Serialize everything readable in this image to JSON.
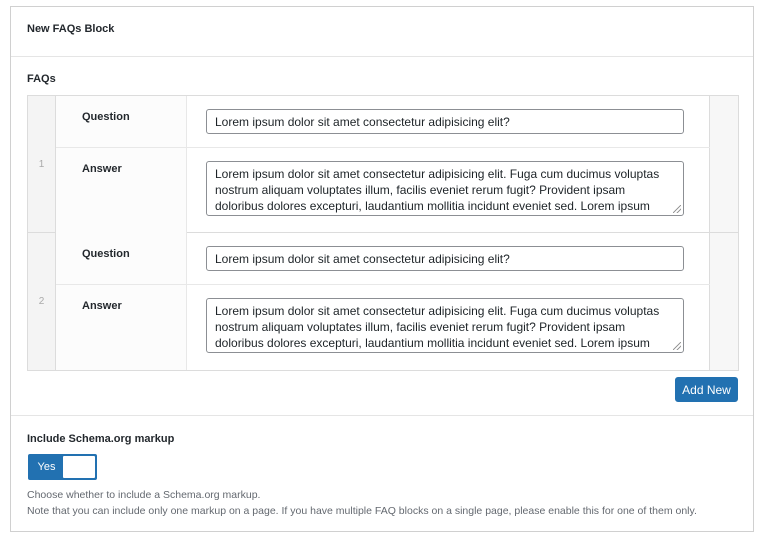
{
  "block_title": "New FAQs Block",
  "faqs_label": "FAQs",
  "rows": [
    {
      "number": "1",
      "question_label": "Question",
      "question_value": "Lorem ipsum dolor sit amet consectetur adipisicing elit?",
      "answer_label": "Answer",
      "answer_value": "Lorem ipsum dolor sit amet consectetur adipisicing elit. Fuga cum ducimus voluptas nostrum aliquam voluptates illum, facilis eveniet rerum fugit? Provident ipsam doloribus dolores excepturi, laudantium mollitia incidunt eveniet sed. Lorem ipsum dolor sit amet"
    },
    {
      "number": "2",
      "question_label": "Question",
      "question_value": "Lorem ipsum dolor sit amet consectetur adipisicing elit?",
      "answer_label": "Answer",
      "answer_value": "Lorem ipsum dolor sit amet consectetur adipisicing elit. Fuga cum ducimus voluptas nostrum aliquam voluptates illum, facilis eveniet rerum fugit? Provident ipsam doloribus dolores excepturi, laudantium mollitia incidunt eveniet sed. Lorem ipsum dolor sit amet"
    }
  ],
  "add_new_label": "Add New",
  "schema": {
    "label": "Include Schema.org markup",
    "toggle_label": "Yes",
    "toggle_state": true,
    "help_line_1": "Choose whether to include a Schema.org markup.",
    "help_line_2": "Note that you can include only one markup on a page. If you have multiple FAQ blocks on a single page, please enable this for one of them only."
  },
  "colors": {
    "accent": "#2271b1",
    "border": "#dcdcdc",
    "help_text": "#646970"
  }
}
